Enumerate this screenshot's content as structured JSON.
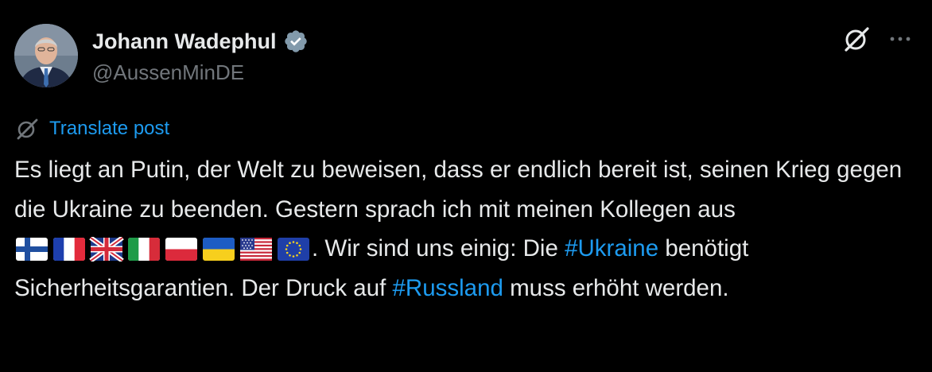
{
  "author": {
    "name": "Johann Wadephul",
    "handle": "@AussenMinDE",
    "verified": true
  },
  "header_icons": [
    "grok-icon",
    "more-icon"
  ],
  "translate": {
    "icon": "translate-icon",
    "label": "Translate post"
  },
  "post": {
    "text_1": "Es liegt an Putin, der Welt zu beweisen, dass er endlich bereit ist, seinen Krieg gegen die Ukraine zu beenden. Gestern sprach ich mit meinen Kollegen aus ",
    "flags": [
      "Finland",
      "France",
      "United Kingdom",
      "Italy",
      "Poland",
      "Ukraine",
      "United States",
      "European Union"
    ],
    "text_2": ". Wir sind uns einig: Die ",
    "hashtag_1": "#Ukraine",
    "text_3": " benötigt Sicherheitsgarantien. Der Druck auf ",
    "hashtag_2": "#Russland",
    "text_4": " muss erhöht werden."
  },
  "colors": {
    "background": "#000000",
    "text": "#e7e9ea",
    "secondary": "#71767b",
    "link": "#1d9bf0",
    "verified_badge": "#829aab"
  }
}
